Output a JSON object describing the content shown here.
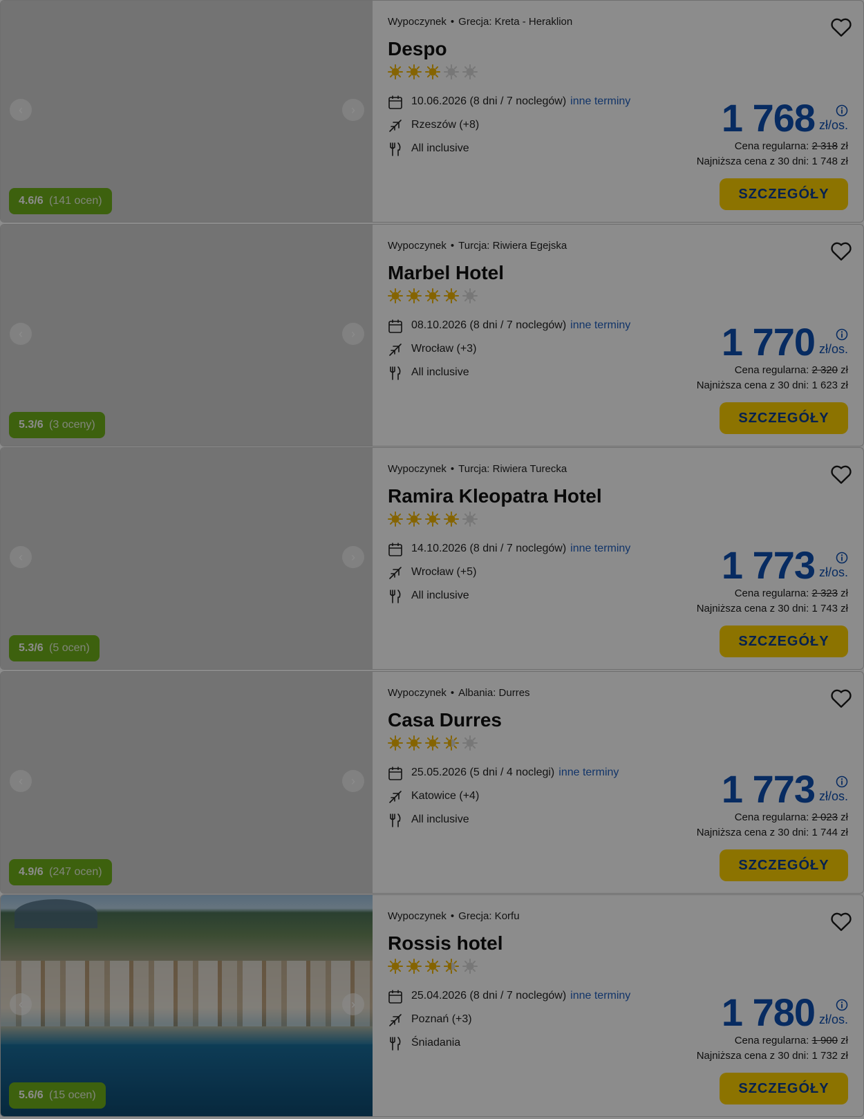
{
  "offers": [
    {
      "category": "Wypoczynek",
      "location": "Grecja: Kreta - Heraklion",
      "name": "Despo",
      "stars": 3,
      "rating_score": "4.6/6",
      "rating_count": "(141 ocen)",
      "date": "10.06.2026 (8 dni / 7 noclegów)",
      "other_dates": "inne terminy",
      "departure": "Rzeszów (+8)",
      "board": "All inclusive",
      "price": "1 768",
      "price_unit": "zł/os.",
      "regular_label": "Cena regularna:",
      "regular_price": "2 318",
      "currency": "zł",
      "lowest_price": "Najniższa cena z 30 dni: 1 748 zł",
      "button": "SZCZEGÓŁY",
      "has_photo": false
    },
    {
      "category": "Wypoczynek",
      "location": "Turcja: Riwiera Egejska",
      "name": "Marbel Hotel",
      "stars": 4,
      "rating_score": "5.3/6",
      "rating_count": "(3 oceny)",
      "date": "08.10.2026 (8 dni / 7 noclegów)",
      "other_dates": "inne terminy",
      "departure": "Wrocław (+3)",
      "board": "All inclusive",
      "price": "1 770",
      "price_unit": "zł/os.",
      "regular_label": "Cena regularna:",
      "regular_price": "2 320",
      "currency": "zł",
      "lowest_price": "Najniższa cena z 30 dni: 1 623 zł",
      "button": "SZCZEGÓŁY",
      "has_photo": false
    },
    {
      "category": "Wypoczynek",
      "location": "Turcja: Riwiera Turecka",
      "name": "Ramira Kleopatra Hotel",
      "stars": 4,
      "rating_score": "5.3/6",
      "rating_count": "(5 ocen)",
      "date": "14.10.2026 (8 dni / 7 noclegów)",
      "other_dates": "inne terminy",
      "departure": "Wrocław (+5)",
      "board": "All inclusive",
      "price": "1 773",
      "price_unit": "zł/os.",
      "regular_label": "Cena regularna:",
      "regular_price": "2 323",
      "currency": "zł",
      "lowest_price": "Najniższa cena z 30 dni: 1 743 zł",
      "button": "SZCZEGÓŁY",
      "has_photo": false
    },
    {
      "category": "Wypoczynek",
      "location": "Albania: Durres",
      "name": "Casa Durres",
      "stars": 3.5,
      "rating_score": "4.9/6",
      "rating_count": "(247 ocen)",
      "date": "25.05.2026 (5 dni / 4 noclegi)",
      "other_dates": "inne terminy",
      "departure": "Katowice (+4)",
      "board": "All inclusive",
      "price": "1 773",
      "price_unit": "zł/os.",
      "regular_label": "Cena regularna:",
      "regular_price": "2 023",
      "currency": "zł",
      "lowest_price": "Najniższa cena z 30 dni: 1 744 zł",
      "button": "SZCZEGÓŁY",
      "has_photo": false
    },
    {
      "category": "Wypoczynek",
      "location": "Grecja: Korfu",
      "name": "Rossis hotel",
      "stars": 3.5,
      "rating_score": "5.6/6",
      "rating_count": "(15 ocen)",
      "date": "25.04.2026 (8 dni / 7 noclegów)",
      "other_dates": "inne terminy",
      "departure": "Poznań (+3)",
      "board": "Śniadania",
      "price": "1 780",
      "price_unit": "zł/os.",
      "regular_label": "Cena regularna:",
      "regular_price": "1 900",
      "currency": "zł",
      "lowest_price": "Najniższa cena z 30 dni: 1 732 zł",
      "button": "SZCZEGÓŁY",
      "has_photo": true
    }
  ],
  "colors": {
    "accent_blue": "#0d4fb1",
    "button_yellow": "#ffd100",
    "rating_green": "#6fb11b",
    "star_gold": "#f2b705",
    "overlay": "rgba(0,0,0,0.45)"
  },
  "icons": {
    "favorite": "heart-icon",
    "date": "calendar-icon",
    "departure": "plane-icon",
    "board": "cutlery-icon",
    "price_info": "info-icon",
    "prev": "chevron-left-icon",
    "next": "chevron-right-icon",
    "star": "sun-icon"
  }
}
